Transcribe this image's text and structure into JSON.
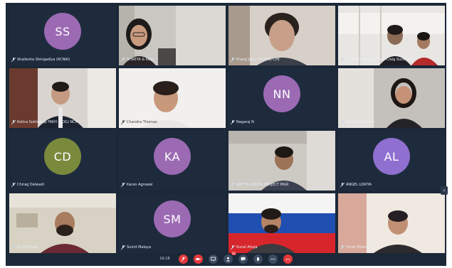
{
  "colors": {
    "background": "#1b2838",
    "tile": "#1e2b3d",
    "active_border": "#3aa7ff",
    "avatar_purple": "#9b6ab3",
    "avatar_olive": "#7a8a3d",
    "avatar_violet": "#8f6fcf",
    "end_call_red": "#e5383b"
  },
  "participants": [
    {
      "initials": "SS",
      "avatar_color": "#9b6ab3",
      "name": "Shailesha Shingadiya (KCNAI)",
      "muted": true
    },
    {
      "initials": "",
      "name": "SHREYA & Ruth",
      "muted": true
    },
    {
      "initials": "",
      "name": "Prasoj Jaini (VGYEN) CPE",
      "muted": true
    },
    {
      "initials": "",
      "name": "Chirag Shah and Ruth Craig Sucet RM",
      "muted": true
    },
    {
      "initials": "",
      "name": "Kottra Sukhonep FAKH (ROG) NCPI",
      "muted": true
    },
    {
      "initials": "",
      "name": "Chandra Thomas",
      "muted": true,
      "active": true
    },
    {
      "initials": "NN",
      "avatar_color": "#9b6ab3",
      "name": "Nagaraj N",
      "muted": true
    },
    {
      "initials": "",
      "name": "Nandini Sharma",
      "muted": true
    },
    {
      "initials": "CD",
      "avatar_color": "#7a8a3d",
      "name": "Chirag Dalwadi",
      "muted": true
    },
    {
      "initials": "KA",
      "avatar_color": "#9b6ab3",
      "name": "Karan Agrawal",
      "muted": true
    },
    {
      "initials": "",
      "name": "ADITYA LOKIYA PROJECT MGR",
      "muted": true
    },
    {
      "initials": "AL",
      "avatar_color": "#8f6fcf",
      "name": "ANGEL LOKIYA",
      "muted": true
    },
    {
      "initials": "",
      "name": "Sumit Misra",
      "muted": true
    },
    {
      "initials": "SM",
      "avatar_color": "#9b6ab3",
      "name": "Sumit Malaya",
      "muted": true
    },
    {
      "initials": "",
      "name": "Kunal Ahuja",
      "muted": true
    },
    {
      "initials": "",
      "name": "Vivek Sharma",
      "muted": true
    }
  ],
  "toolbar": {
    "timer": "16:18",
    "buttons": [
      {
        "icon": "mic-off-icon",
        "color": "#e5383b"
      },
      {
        "icon": "video-off-icon",
        "color": "#e5383b"
      },
      {
        "icon": "share-screen-icon",
        "color": "#3b4a5f"
      },
      {
        "icon": "participants-icon",
        "color": "#3b4a5f",
        "badge": "16"
      },
      {
        "icon": "chat-icon",
        "color": "#3b4a5f"
      },
      {
        "icon": "raise-hand-icon",
        "color": "#3b4a5f"
      },
      {
        "icon": "more-icon",
        "color": "#3b4a5f"
      },
      {
        "icon": "end-call-icon",
        "color": "#e5383b"
      }
    ]
  }
}
